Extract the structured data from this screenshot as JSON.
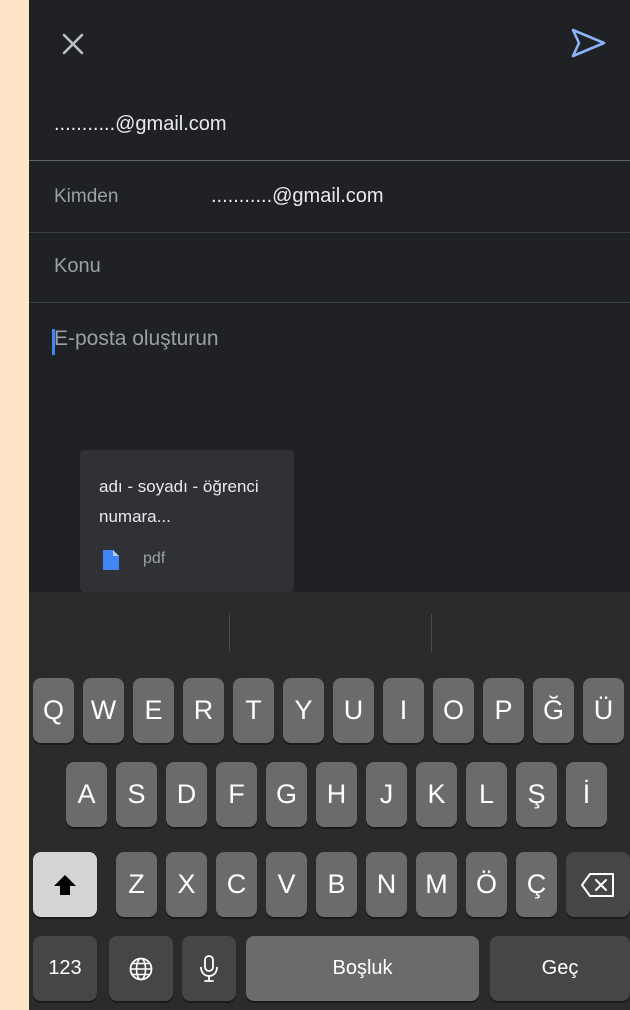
{
  "compose": {
    "to_value": "...........@gmail.com",
    "from_label": "Kimden",
    "from_value": "...........@gmail.com",
    "subject_placeholder": "Konu",
    "body_placeholder": "E-posta oluşturun"
  },
  "attachment": {
    "name": "adı - soyadı - öğrenci numara...",
    "type": "pdf",
    "icon": "file-icon"
  },
  "icons": {
    "close": "close-icon",
    "send": "send-icon"
  },
  "colors": {
    "background": "#202124",
    "accent": "#4285f4",
    "keyboard": "#2b2b2b"
  },
  "keyboard": {
    "row1": [
      "Q",
      "W",
      "E",
      "R",
      "T",
      "Y",
      "U",
      "I",
      "O",
      "P",
      "Ğ",
      "Ü"
    ],
    "row2": [
      "A",
      "S",
      "D",
      "F",
      "G",
      "H",
      "J",
      "K",
      "L",
      "Ş",
      "İ"
    ],
    "row3": [
      "Z",
      "X",
      "C",
      "V",
      "B",
      "N",
      "M",
      "Ö",
      "Ç"
    ],
    "numbers_label": "123",
    "space_label": "Boşluk",
    "return_label": "Geç"
  }
}
